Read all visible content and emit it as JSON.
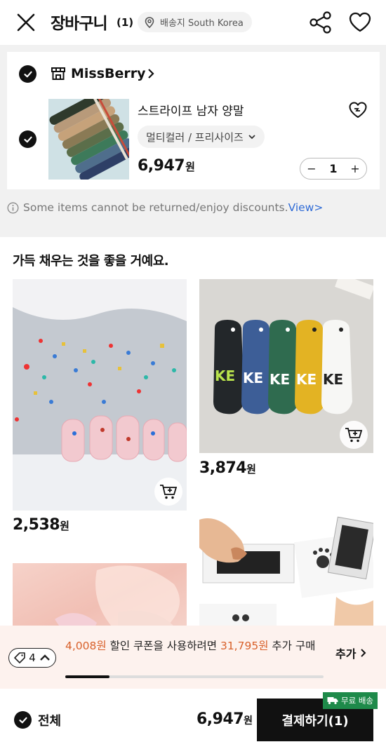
{
  "header": {
    "title": "장바구니",
    "count": "(1)",
    "shipping_label": "배송지 South Korea"
  },
  "store": {
    "name": "MissBerry"
  },
  "item": {
    "name": "스트라이프 남자 양말",
    "option": "멀티컬러 / 프리사이즈",
    "price": "6,947",
    "currency": "원",
    "quantity": "1",
    "minus": "−",
    "plus": "+"
  },
  "notice": {
    "text": "Some items cannot be returned/enjoy discounts.",
    "link": "View>"
  },
  "recommend": {
    "title": "가득 채우는 것을 좋을 거예요.",
    "products": [
      {
        "price": "2,538",
        "currency": "원"
      },
      {
        "price": "3,874",
        "currency": "원"
      }
    ]
  },
  "coupon": {
    "badge_count": "4",
    "amount": "4,008원",
    "text_mid": " 할인 쿠폰을 사용하려면 ",
    "need": "31,795원",
    "text_end": " 추가 구매",
    "add_label": "추가",
    "progress": 0.17
  },
  "footer": {
    "all_label": "전체",
    "total": "6,947",
    "currency": "원",
    "pay_label": "결제하기(1)",
    "free_shipping": "무료 배송"
  },
  "colors": {
    "accent_orange": "#d8602a",
    "link_blue": "#2f6bd6",
    "free_ship_green": "#1e8a4a"
  }
}
